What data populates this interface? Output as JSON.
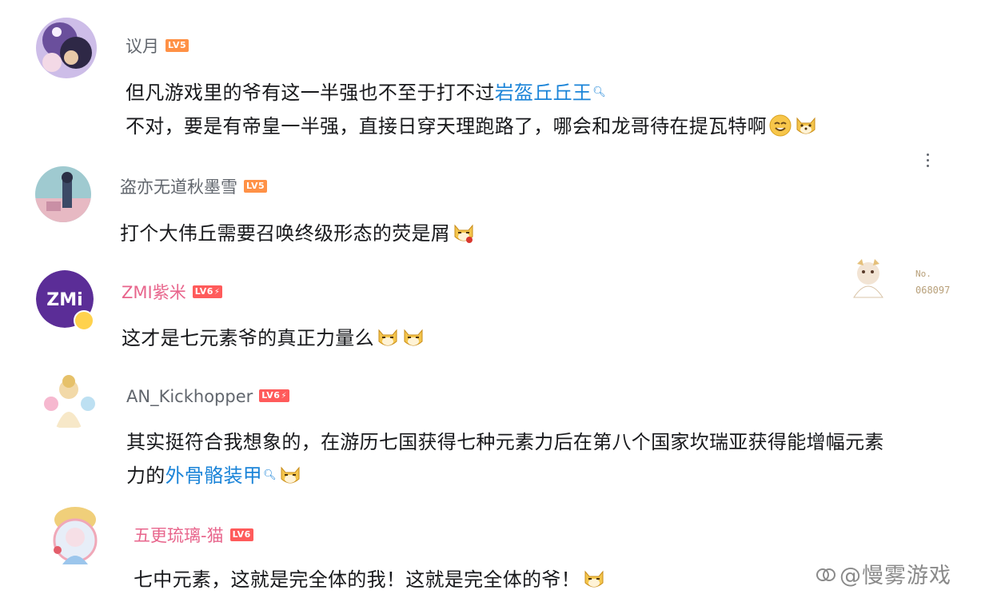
{
  "comments": [
    {
      "username": "议月",
      "level": "LV5",
      "lines": [
        {
          "text": "但凡游戏里的爷有这一半强也不至于打不过",
          "link": "岩盔丘丘王",
          "after": ""
        },
        {
          "text": "不对，要是有帝皇一半强，直接日穿天理跑路了，哪会和龙哥待在提瓦特啊",
          "link": "",
          "after": ""
        }
      ]
    },
    {
      "username": "盗亦无道秋墨雪",
      "level": "LV5",
      "lines": [
        {
          "text": "打个大伟丘需要召唤终级形态的荧是屑",
          "link": "",
          "after": ""
        }
      ]
    },
    {
      "username": "ZMI紫米",
      "level": "LV6",
      "avatar_text": "ZMi",
      "lines": [
        {
          "text": "这才是七元素爷的真正力量么",
          "link": "",
          "after": ""
        }
      ]
    },
    {
      "username": "AN_Kickhopper",
      "level": "LV6",
      "lines": [
        {
          "text": "其实挺符合我想象的，在游历七国获得七种元素力后在第八个国家坎瑞亚获得能增幅元素",
          "link": "",
          "after": ""
        },
        {
          "text": "力的",
          "link": "外骨骼装甲",
          "after": ""
        }
      ]
    },
    {
      "username": "五更琉璃-猫",
      "level": "LV6",
      "lines": [
        {
          "text": "七中元素，这就是完全体的我！这就是完全体的爷！",
          "link": "",
          "after": ""
        }
      ]
    }
  ],
  "badge": {
    "no_label": "No.",
    "number": "068097"
  },
  "watermark": "@慢雾游戏",
  "colors": {
    "link": "#1b84d8",
    "lv5": "#ff9146",
    "lv6": "#ff5b5b",
    "zmi_avatar": "#5b2d97",
    "username_pink": "#e8658c",
    "username_default": "#61666d"
  },
  "icons": [
    "search-icon",
    "dog-emoji",
    "smile-emoji",
    "more-icon"
  ]
}
